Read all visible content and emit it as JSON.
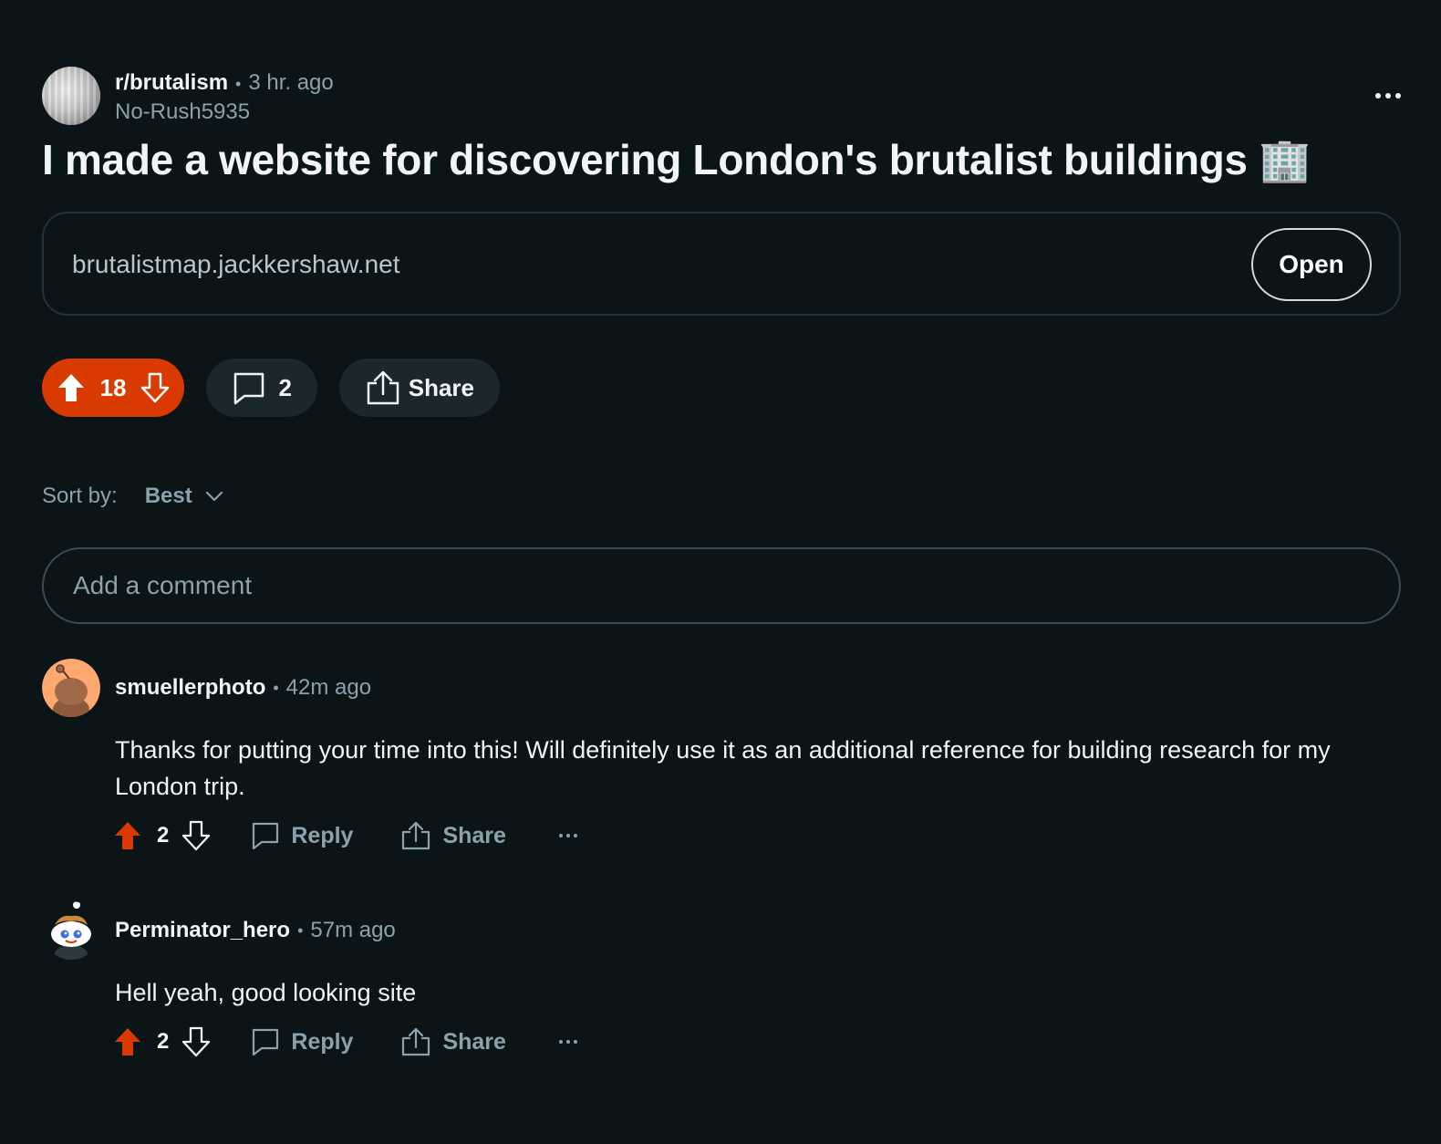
{
  "post": {
    "subreddit": "r/brutalism",
    "time_ago": "3 hr. ago",
    "author": "No-Rush5935",
    "title": "I made a website for discovering London's brutalist buildings 🏢",
    "link_url": "brutalistmap.jackkershaw.net",
    "open_label": "Open",
    "score": "18",
    "comment_count": "2",
    "share_label": "Share"
  },
  "sort": {
    "label": "Sort by:",
    "value": "Best"
  },
  "comment_input": {
    "placeholder": "Add a comment"
  },
  "comments": [
    {
      "username": "smuellerphoto",
      "time_ago": "42m ago",
      "body": "Thanks for putting your time into this! Will definitely use it as an additional reference for building research for my London trip.",
      "score": "2",
      "reply_label": "Reply",
      "share_label": "Share"
    },
    {
      "username": "Perminator_hero",
      "time_ago": "57m ago",
      "body": "Hell yeah, good looking site",
      "score": "2",
      "reply_label": "Reply",
      "share_label": "Share"
    }
  ],
  "colors": {
    "background": "#0b1416",
    "upvote_active": "#d93a00",
    "muted_text": "#8ba2ad",
    "pill_bg": "#1a282d"
  },
  "icons": [
    "more-icon",
    "upvote-icon",
    "downvote-icon",
    "comment-icon",
    "share-icon",
    "chevron-down-icon"
  ]
}
